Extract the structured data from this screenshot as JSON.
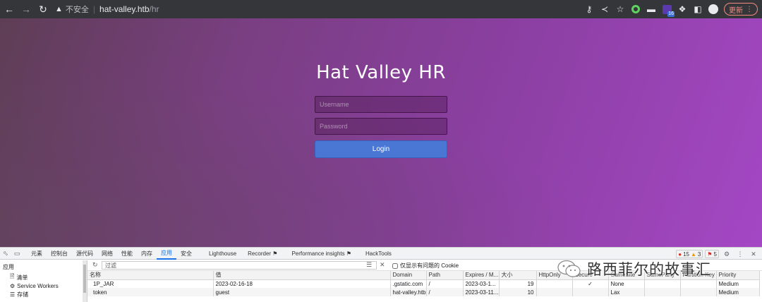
{
  "browser": {
    "insecure_label": "不安全",
    "url_host": "hat-valley.htb",
    "url_path": "/hr",
    "extension_badge": "16",
    "update_label": "更新"
  },
  "page": {
    "title": "Hat Valley HR",
    "username_placeholder": "Username",
    "password_placeholder": "Password",
    "login_label": "Login"
  },
  "devtools": {
    "tabs": [
      "元素",
      "控制台",
      "源代码",
      "网络",
      "性能",
      "内存",
      "应用",
      "安全",
      "Lighthouse",
      "Recorder",
      "Performance insights",
      "HackTools"
    ],
    "active_tab": "应用",
    "errors_count": "15",
    "warnings_count": "3",
    "issues_count": "5",
    "sidebar": {
      "heading": "应用",
      "items": [
        {
          "label": "清单",
          "icon": "document-icon"
        },
        {
          "label": "Service Workers",
          "icon": "gear-icon"
        },
        {
          "label": "存储",
          "icon": "database-icon"
        }
      ]
    },
    "filter_placeholder": "过滤",
    "only_issues_label": "仅显示有问题的 Cookie",
    "columns": [
      "名称",
      "值",
      "Domain",
      "Path",
      "Expires / M...",
      "大小",
      "HttpOnly",
      "Secure",
      "SameSite",
      "SameParty",
      "Partition Key",
      "Priority"
    ],
    "rows": [
      {
        "name": "1P_JAR",
        "value": "2023-02-16-18",
        "domain": ".gstatic.com",
        "path": "/",
        "expires": "2023-03-1...",
        "size": "19",
        "httponly": "",
        "secure": "✓",
        "samesite": "None",
        "sameparty": "",
        "partition": "",
        "priority": "Medium"
      },
      {
        "name": "token",
        "value": "guest",
        "domain": "hat-valley.htb",
        "path": "/",
        "expires": "2023-03-11...",
        "size": "10",
        "httponly": "",
        "secure": "",
        "samesite": "Lax",
        "sameparty": "",
        "partition": "",
        "priority": "Medium"
      }
    ]
  },
  "watermark": {
    "text": "路西菲尔的故事汇"
  }
}
